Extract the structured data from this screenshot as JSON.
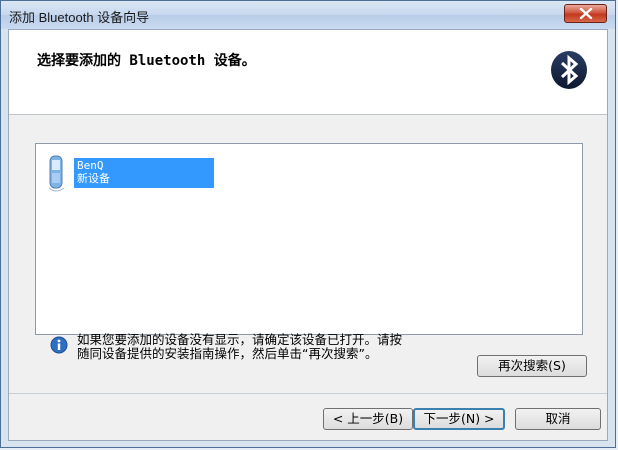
{
  "window": {
    "title": "添加 Bluetooth 设备向导"
  },
  "header": {
    "title": "选择要添加的 Bluetooth 设备。"
  },
  "device_list": {
    "items": [
      {
        "name": "BenQ",
        "status": "新设备",
        "selected": true,
        "icon": "phone-icon"
      }
    ]
  },
  "info": {
    "line1": "如果您要添加的设备没有显示，请确定该设备已打开。请按",
    "line2": "随同设备提供的安装指南操作，然后单击“再次搜索”。",
    "icon": "info-icon"
  },
  "buttons": {
    "rescan": "再次搜索(S)",
    "back": "< 上一步(B)",
    "next": "下一步(N) >",
    "cancel": "取消"
  },
  "colors": {
    "selection": "#3399ff",
    "close": "#c2381e",
    "titlebar": "#c7d8ee"
  }
}
